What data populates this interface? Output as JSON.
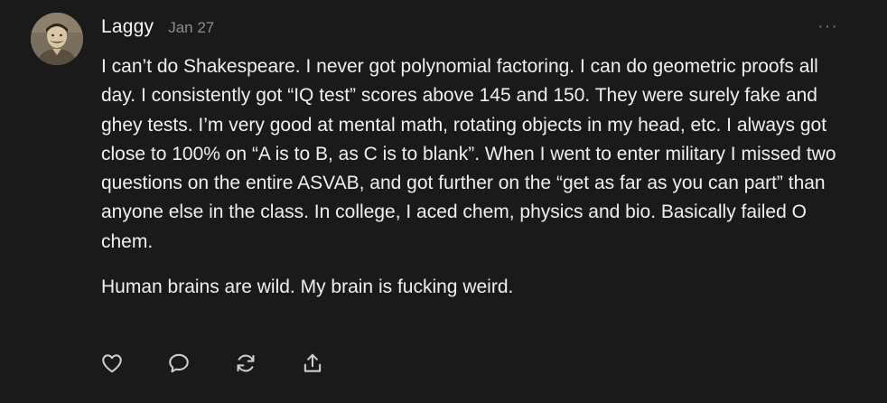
{
  "post": {
    "author": "Laggy",
    "date": "Jan 27",
    "more_icon": "ellipsis-icon",
    "paragraphs": [
      "I can’t do Shakespeare. I never got polynomial factoring. I can do geometric proofs all day. I consistently got “IQ test” scores above 145 and 150. They were surely fake and ghey tests. I’m very good at mental math, rotating objects in my head, etc. I always got close to 100% on “A is to B, as C is to blank”. When I went to enter military I missed two questions on the entire ASVAB, and got further on the “get as far as you can part” than anyone else in the class. In college, I aced chem, physics and bio. Basically failed O chem.",
      "Human brains are wild. My brain is fucking weird."
    ]
  },
  "actions": [
    {
      "icon": "heart-icon"
    },
    {
      "icon": "comment-icon"
    },
    {
      "icon": "restack-icon"
    },
    {
      "icon": "share-icon"
    }
  ],
  "colors": {
    "background": "#1a1a1a",
    "text": "#f0f0f0",
    "muted": "#8e8e8e",
    "icon": "#cfcfcf"
  }
}
